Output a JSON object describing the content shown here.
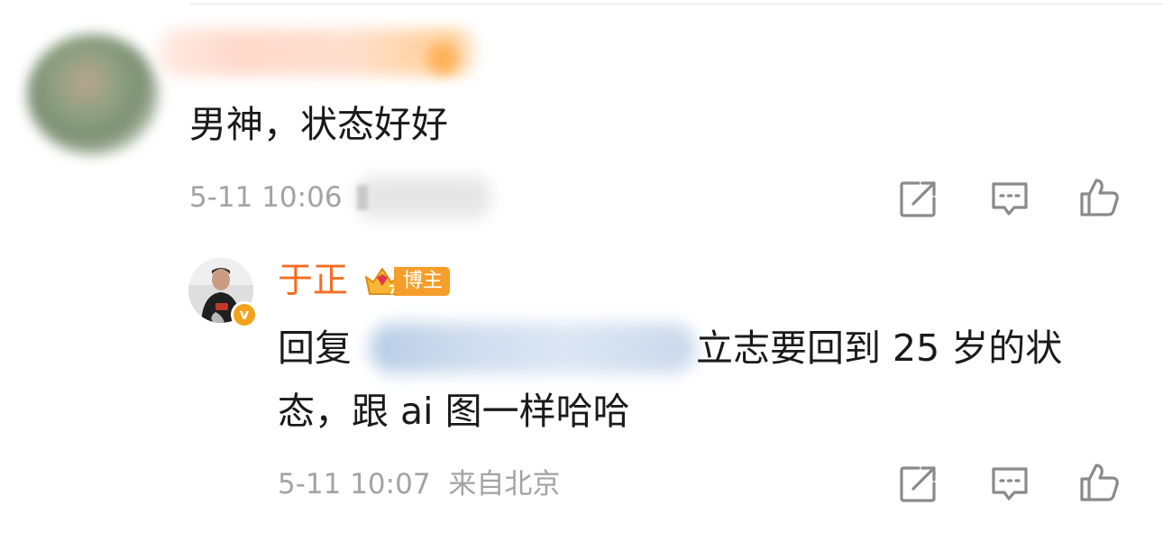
{
  "comment": {
    "text": "男神，状态好好",
    "timestamp": "5-11 10:06"
  },
  "reply": {
    "author": "于正",
    "badge_level": "7",
    "badge_label": "博主",
    "verified_mark": "v",
    "prefix": "回复",
    "text_tail": "立志要回到 25 岁的状",
    "text_line2": "态，跟 ai 图一样哈哈",
    "timestamp": "5-11 10:07",
    "location": "来自北京"
  },
  "actions": {
    "icons": [
      "share-icon",
      "comment-icon",
      "like-icon"
    ]
  },
  "colors": {
    "author_name": "#f56d1f",
    "badge": "#f59e2a",
    "meta_text": "#a3a3a3",
    "icon_stroke": "#8a8a8a",
    "verified": "#f4a21a"
  }
}
